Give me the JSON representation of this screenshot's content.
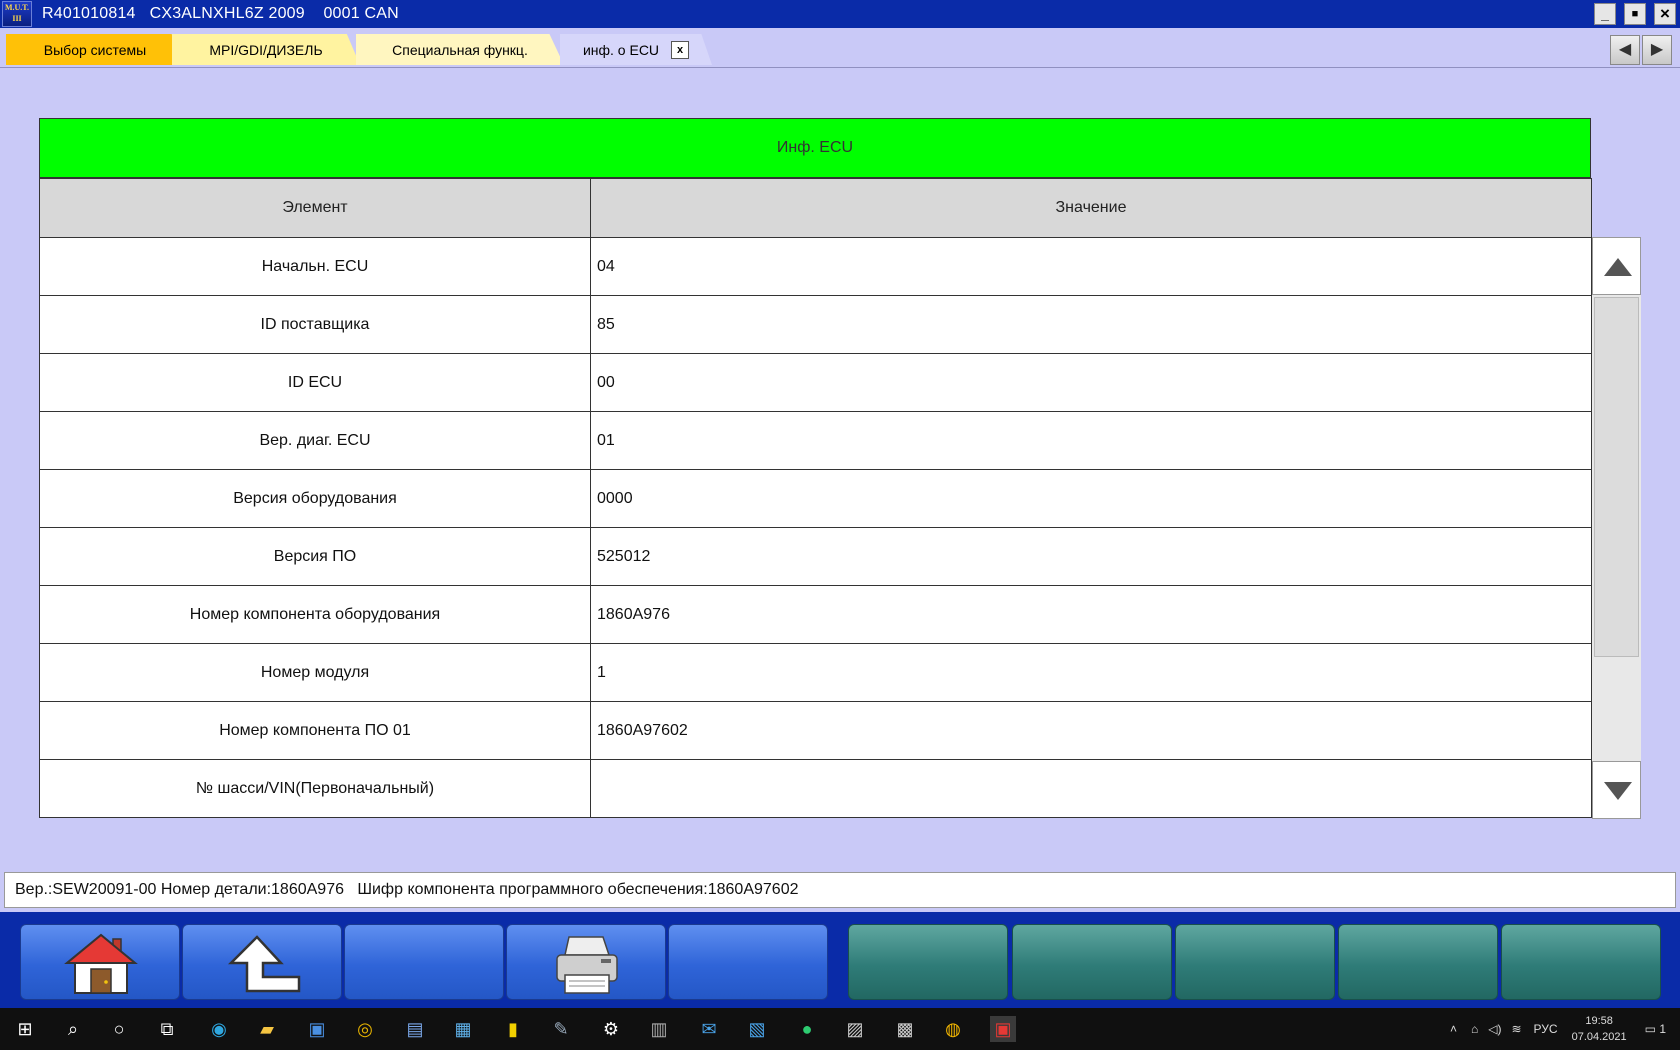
{
  "window": {
    "title": "R401010814   CX3ALNXHL6Z 2009    0001 CAN",
    "logo_text": "M.U.T.",
    "logo_sub": "III",
    "minimize_label": "_",
    "maximize_label": "■",
    "close_label": "×"
  },
  "tabs": [
    {
      "label": "Выбор системы",
      "color": "#ffc107"
    },
    {
      "label": "MPI/GDI/ДИЗЕЛЬ",
      "color": "#fff3a0"
    },
    {
      "label": "Специальная функц.",
      "color": "#fff6c0"
    },
    {
      "label": "инф. о ECU",
      "color": "#c9c9f7",
      "close": "x"
    }
  ],
  "tab_nav": {
    "prev": "◀",
    "next": "▶"
  },
  "table": {
    "title": "Инф. ECU",
    "title_color": "#00ff00",
    "columns": [
      "Элемент",
      "Значение"
    ],
    "rows": [
      {
        "element": "Начальн. ECU",
        "value": "04"
      },
      {
        "element": "ID поставщика",
        "value": "85"
      },
      {
        "element": "ID ECU",
        "value": "00"
      },
      {
        "element": "Вер. диаг. ECU",
        "value": "01"
      },
      {
        "element": "Версия оборудования",
        "value": "0000"
      },
      {
        "element": "Версия ПО",
        "value": "525012"
      },
      {
        "element": "Номер компонента оборудования",
        "value": "1860A976"
      },
      {
        "element": "Номер модуля",
        "value": "1"
      },
      {
        "element": "Номер компонента ПО 01",
        "value": "1860A97602"
      },
      {
        "element": "№ шасси/VIN(Первоначальный)",
        "value": ""
      }
    ]
  },
  "status_line": "Вер.:SEW20091-00 Номер детали:1860A976   Шифр компонента программного обеспечения:1860A97602",
  "function_buttons": [
    {
      "icon": "home-icon"
    },
    {
      "icon": "back-arrow-icon"
    },
    {
      "icon": ""
    },
    {
      "icon": "printer-icon"
    },
    {
      "icon": ""
    },
    {
      "icon": ""
    },
    {
      "icon": ""
    },
    {
      "icon": ""
    },
    {
      "icon": ""
    },
    {
      "icon": ""
    }
  ],
  "taskbar": {
    "language": "РУС",
    "time": "19:58",
    "date": "07.04.2021",
    "notification_count": "1"
  }
}
